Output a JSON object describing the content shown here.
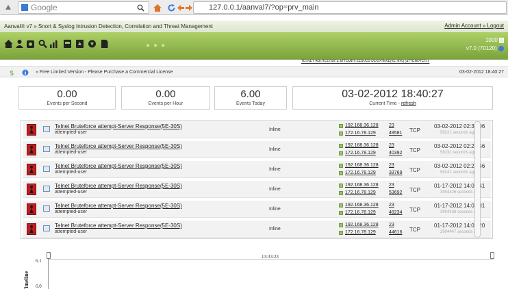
{
  "browser": {
    "search_placeholder": "Google",
    "url": "127.0.0.1/aanval7/?op=prv_main"
  },
  "app": {
    "title": "Aanval® v7 » Snort & Syslog Intrusion Detection, Correlation and Threat Management",
    "account_link": "Admin Account",
    "separator": " » ",
    "logout_link": "Logout",
    "count": "1000",
    "version": "v7.0 (70120)"
  },
  "ticker": "TELNET BRUTEFORCE ATTEMPT-SERVER RESPONSE(5E-30S) (ATTEMPTED-L",
  "license": {
    "text": "» Free Limited Version - Please Purchase a Commercial License",
    "date": "03-02-2012 18:40:27"
  },
  "stats": [
    {
      "value": "0.00",
      "label": "Events per Second"
    },
    {
      "value": "0.00",
      "label": "Events per Hour"
    },
    {
      "value": "6.00",
      "label": "Events Today"
    }
  ],
  "clock": {
    "value": "03-02-2012 18:40:27",
    "label": "Current Time - ",
    "refresh": "refresh"
  },
  "alerts": [
    {
      "signature": "Telnet Bruteforce attempt-Server Response(5E-30S)",
      "classification": "attempted-user",
      "mode": "Inline",
      "src_ip": "192.168.36.128",
      "dst_ip": "172.16.78.129",
      "src_port": "23",
      "dst_port": "49581",
      "protocol": "TCP",
      "timestamp": "03-02-2012 02:30:06",
      "ago": "58221 seconds ago"
    },
    {
      "signature": "Telnet Bruteforce attempt-Server Response(5E-30S)",
      "classification": "attempted-user",
      "mode": "Inline",
      "src_ip": "192.168.36.128",
      "dst_ip": "172.16.78.129",
      "src_port": "23",
      "dst_port": "40392",
      "protocol": "TCP",
      "timestamp": "03-02-2012 02:29:56",
      "ago": "58231 seconds ago"
    },
    {
      "signature": "Telnet Bruteforce attempt-Server Response(5E-30S)",
      "classification": "attempted-user",
      "mode": "Inline",
      "src_ip": "192.168.36.128",
      "dst_ip": "172.16.78.129",
      "src_port": "23",
      "dst_port": "33769",
      "protocol": "TCP",
      "timestamp": "03-02-2012 02:29:46",
      "ago": "58241 seconds ago"
    },
    {
      "signature": "Telnet Bruteforce attempt-Server Response(5E-30S)",
      "classification": "attempted-user",
      "mode": "Inline",
      "src_ip": "192.168.36.128",
      "dst_ip": "172.16.78.129",
      "src_port": "23",
      "dst_port": "53692",
      "protocol": "TCP",
      "timestamp": "01-17-2012 14:06:41",
      "ago": "3904426 seconds ago"
    },
    {
      "signature": "Telnet Bruteforce attempt-Server Response(5E-30S)",
      "classification": "attempted-user",
      "mode": "Inline",
      "src_ip": "192.168.36.128",
      "dst_ip": "172.16.78.129",
      "src_port": "23",
      "dst_port": "48234",
      "protocol": "TCP",
      "timestamp": "01-17-2012 14:06:31",
      "ago": "3904436 seconds ago"
    },
    {
      "signature": "Telnet Bruteforce attempt-Server Response(5E-30S)",
      "classification": "attempted-user",
      "mode": "Inline",
      "src_ip": "192.168.36.128",
      "dst_ip": "172.16.78.129",
      "src_port": "23",
      "dst_port": "44616",
      "protocol": "TCP",
      "timestamp": "01-17-2012 14:06:20",
      "ago": "3904447 seconds ago"
    }
  ],
  "timeline": {
    "time_label": "13:33:23",
    "y_ticks": [
      "6.1",
      "6.0"
    ],
    "axis_label": "Timeline"
  },
  "colors": {
    "nav_green": "#8cb648",
    "severity_red": "#c01e1e"
  }
}
